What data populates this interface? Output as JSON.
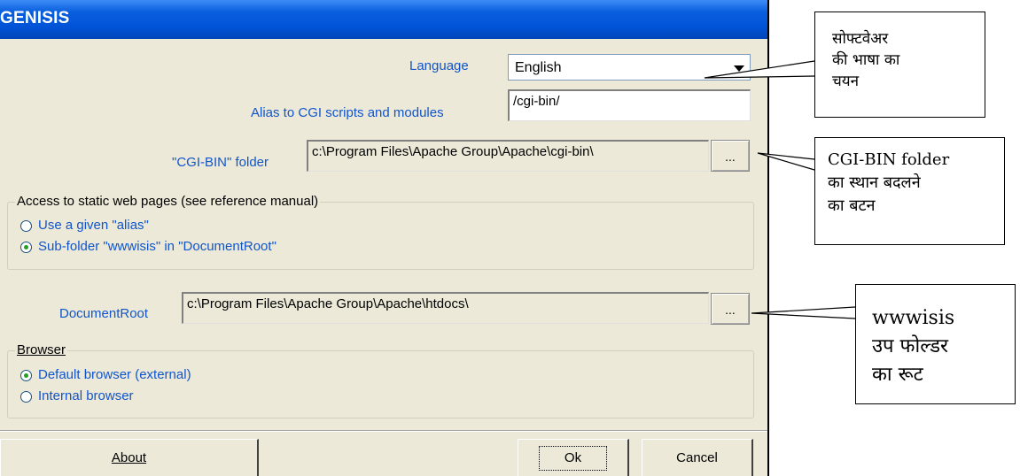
{
  "window": {
    "title": "GENISIS"
  },
  "form": {
    "language_label": "Language",
    "language_value": "English",
    "alias_label": "Alias to CGI scripts and modules",
    "alias_value": "/cgi-bin/",
    "cgibin_label": "\"CGI-BIN\" folder",
    "cgibin_value": "c:\\Program Files\\Apache Group\\Apache\\cgi-bin\\",
    "browse_label": "...",
    "static_group_label": "Access to static web pages (see reference manual)",
    "static_options": [
      {
        "label": "Use a given \"alias\"",
        "selected": false
      },
      {
        "label": "Sub-folder \"wwwisis\" in \"DocumentRoot\"",
        "selected": true
      }
    ],
    "docroot_label": "DocumentRoot",
    "docroot_value": "c:\\Program Files\\Apache Group\\Apache\\htdocs\\",
    "browser_group_label": "Browser",
    "browser_options": [
      {
        "label": "Default browser (external)",
        "selected": true
      },
      {
        "label": "Internal browser",
        "selected": false
      }
    ]
  },
  "buttons": {
    "about": "About",
    "ok": "Ok",
    "cancel": "Cancel"
  },
  "callouts": {
    "language": "सोफ्टवेअर\nकी भाषा का\nचयन",
    "cgibin": "CGI-BIN folder\nका स्थान बदलने\nका बटन",
    "docroot": "wwwisis\nउप फोल्डर\nका रूट"
  },
  "colors": {
    "label_blue": "#1155cc",
    "title_blue": "#0053d6",
    "dialog_bg": "#ece9d8"
  }
}
